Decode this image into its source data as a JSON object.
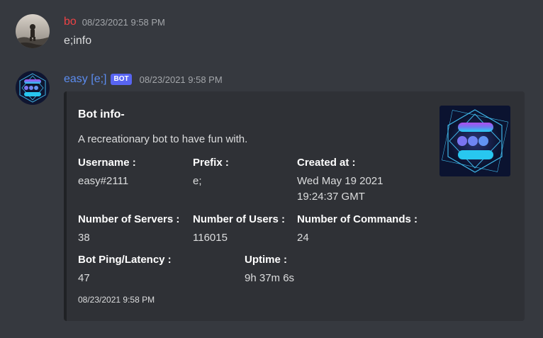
{
  "colors": {
    "background": "#36393f",
    "user_bo_name": "#ed4245",
    "user_easy_name": "#5c8df0",
    "bot_tag": "#5865f2",
    "embed_bg": "#2f3136",
    "embed_border": "#202225"
  },
  "messages": [
    {
      "author": "bo",
      "timestamp": "08/23/2021 9:58 PM",
      "content": "e;info",
      "avatar_icon": "user-photo-avatar"
    },
    {
      "author": "easy [e;]",
      "bot_tag": "BOT",
      "timestamp": "08/23/2021 9:58 PM",
      "avatar_icon": "bot-logo-avatar",
      "embed": {
        "title": "Bot info-",
        "description": "A recreationary bot to have fun with.",
        "thumbnail_icon": "bot-logo-thumbnail",
        "fields": [
          {
            "name": "Username :",
            "value": "easy#2111"
          },
          {
            "name": "Prefix :",
            "value": "e;"
          },
          {
            "name": "Created at :",
            "value_lines": [
              "Wed May 19 2021",
              "19:24:37 GMT"
            ]
          },
          {
            "name": "Number of Servers :",
            "value": "38"
          },
          {
            "name": "Number of Users :",
            "value": "116015"
          },
          {
            "name": "Number of Commands :",
            "value": "24"
          },
          {
            "name": "Bot Ping/Latency :",
            "value": "47"
          },
          {
            "name": "Uptime :",
            "value": "9h 37m 6s"
          }
        ],
        "footer": "08/23/2021 9:58 PM"
      }
    }
  ]
}
